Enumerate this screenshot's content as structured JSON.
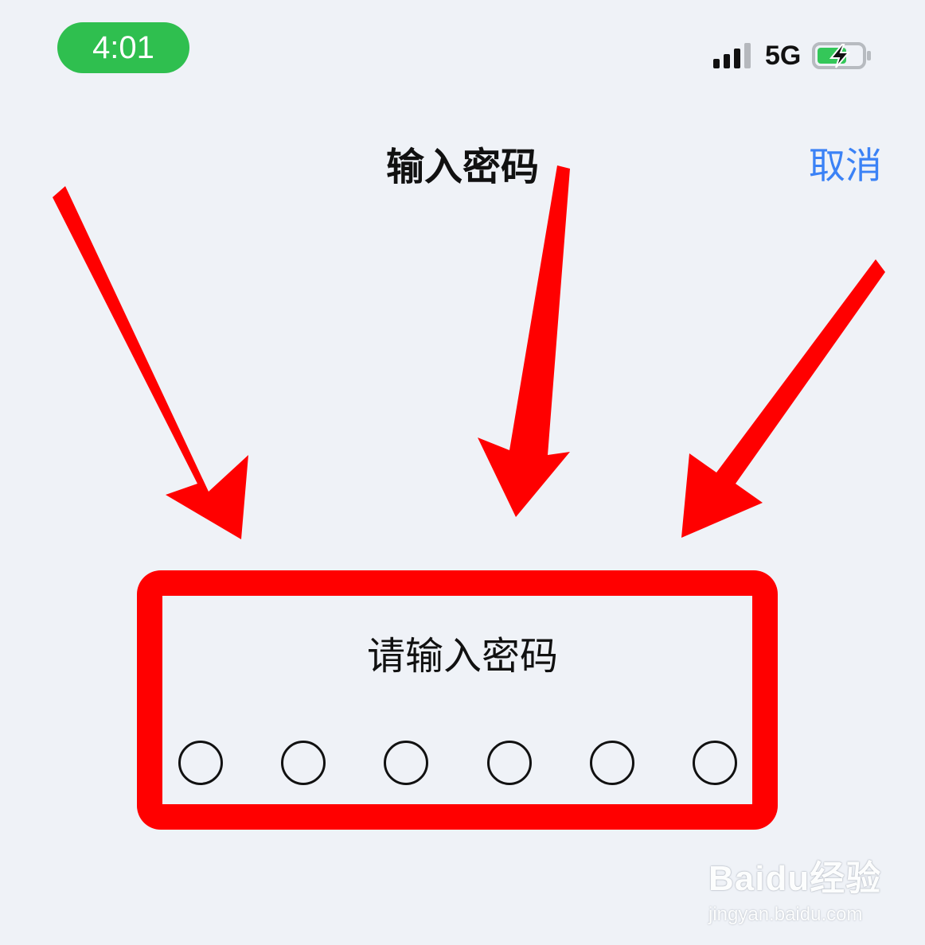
{
  "status_bar": {
    "time": "4:01",
    "network": "5G",
    "signal_bars_active": 3,
    "signal_bars_total": 4,
    "battery_state": "charging",
    "time_pill_color": "#2fbf4f"
  },
  "header": {
    "title": "输入密码",
    "cancel_label": "取消",
    "cancel_color": "#3b82f6"
  },
  "password_panel": {
    "prompt": "请输入密码",
    "digit_count": 6,
    "filled_count": 0
  },
  "annotations": {
    "arrow_color": "#ff0000",
    "highlight_color": "#ff0000",
    "arrow_count": 3
  },
  "watermark": {
    "logo": "Baidu经验",
    "url": "jingyan.baidu.com"
  },
  "icons": [
    "signal-icon",
    "battery-charging-icon",
    "arrow-icon"
  ]
}
